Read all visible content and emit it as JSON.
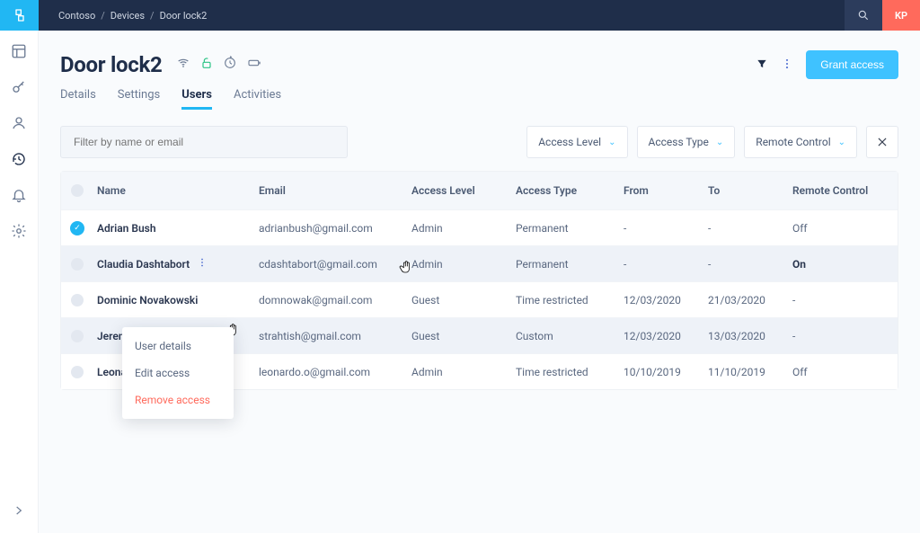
{
  "breadcrumb": {
    "org": "Contoso",
    "section": "Devices",
    "item": "Door lock2"
  },
  "avatar": "KP",
  "title": "Door lock2",
  "grant_btn": "Grant access",
  "tabs": [
    "Details",
    "Settings",
    "Users",
    "Activities"
  ],
  "active_tab": 2,
  "filter_placeholder": "Filter by name or email",
  "filters": {
    "f1": "Access Level",
    "f2": "Access Type",
    "f3": "Remote Control"
  },
  "columns": {
    "name": "Name",
    "email": "Email",
    "alevel": "Access Level",
    "atype": "Access Type",
    "from": "From",
    "to": "To",
    "rc": "Remote Control"
  },
  "rows": [
    {
      "checked": true,
      "name": "Adrian Bush",
      "email": "adrianbush@gmail.com",
      "alevel": "Admin",
      "atype": "Permanent",
      "from": "-",
      "to": "-",
      "rc": "Off",
      "hover": false
    },
    {
      "checked": false,
      "name": "Claudia Dashtabort",
      "email": "cdashtabort@gmail.com",
      "alevel": "Admin",
      "atype": "Permanent",
      "from": "-",
      "to": "-",
      "rc": "On",
      "hover": true,
      "more": true,
      "strongRc": true
    },
    {
      "checked": false,
      "name": "Dominic Novakowski",
      "email": "domnowak@gmail.com",
      "alevel": "Guest",
      "atype": "Time restricted",
      "from": "12/03/2020",
      "to": "21/03/2020",
      "rc": "-",
      "hover": false
    },
    {
      "checked": false,
      "name": "Jeremi Strahtish",
      "email": "strahtish@gmail.com",
      "alevel": "Guest",
      "atype": "Custom",
      "from": "12/03/2020",
      "to": "13/03/2020",
      "rc": "-",
      "hover": true,
      "more": true
    },
    {
      "checked": false,
      "name": "Leona",
      "email": "leonardo.o@gmail.com",
      "alevel": "Admin",
      "atype": "Time restricted",
      "from": "10/10/2019",
      "to": "11/10/2019",
      "rc": "Off",
      "hover": false
    }
  ],
  "ctx_row_index": 3,
  "menu": {
    "details": "User details",
    "edit": "Edit access",
    "remove": "Remove access"
  }
}
